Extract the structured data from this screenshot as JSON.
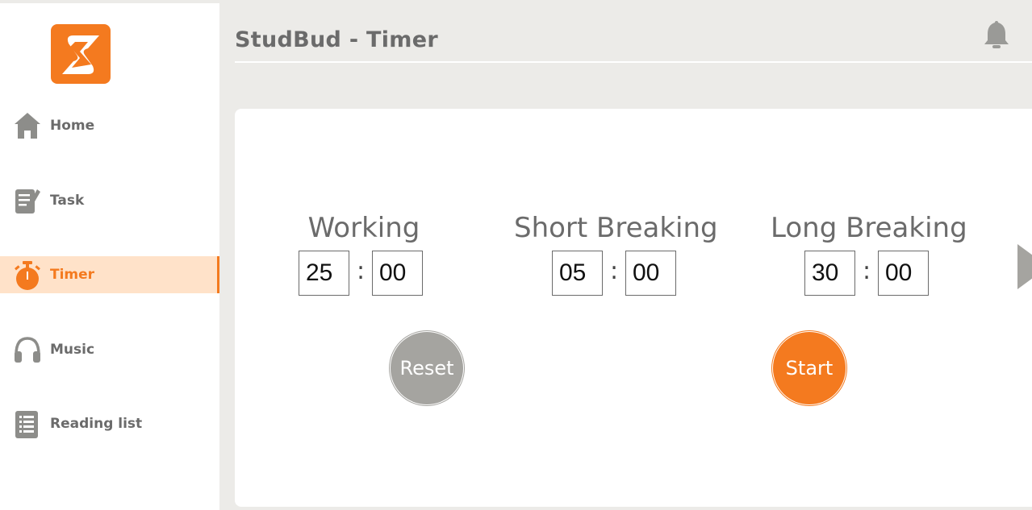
{
  "app": {
    "title": "StudBud - Timer"
  },
  "sidebar": {
    "logo_letter": "S",
    "items": [
      {
        "label": "Home",
        "icon": "home-icon"
      },
      {
        "label": "Task",
        "icon": "task-icon"
      },
      {
        "label": "Timer",
        "icon": "stopwatch-icon",
        "active": true
      },
      {
        "label": "Music",
        "icon": "headphones-icon"
      },
      {
        "label": "Reading list",
        "icon": "list-icon"
      }
    ]
  },
  "timers": [
    {
      "label": "Working",
      "minutes": "25",
      "seconds": "00"
    },
    {
      "label": "Short Breaking",
      "minutes": "05",
      "seconds": "00"
    },
    {
      "label": "Long Breaking",
      "minutes": "30",
      "seconds": "00"
    }
  ],
  "buttons": {
    "reset": "Reset",
    "start": "Start"
  },
  "separator": ":",
  "colors": {
    "accent": "#f47a1f",
    "active_bg": "#ffe2c9",
    "muted": "#a5a4a0",
    "text": "#6b6b6b",
    "bg": "#ecebe8"
  }
}
